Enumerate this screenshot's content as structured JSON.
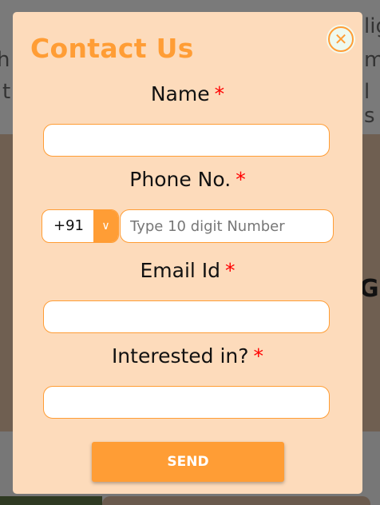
{
  "background": {
    "fragments": [
      "lig",
      "h",
      "mi",
      "t",
      "l s",
      "Gr"
    ]
  },
  "modal": {
    "title": "Contact Us",
    "close_icon": "close-circle-icon",
    "required_mark": "*",
    "fields": {
      "name": {
        "label": "Name",
        "value": ""
      },
      "phone": {
        "label": "Phone No.",
        "country_code": "+91",
        "placeholder": "Type 10 digit Number",
        "value": ""
      },
      "email": {
        "label": "Email Id",
        "value": ""
      },
      "interest": {
        "label": "Interested in?",
        "value": ""
      }
    },
    "send_label": "SEND"
  },
  "colors": {
    "accent": "#ff9d35",
    "modal_bg": "#fddbbb",
    "required": "#ff0000"
  }
}
